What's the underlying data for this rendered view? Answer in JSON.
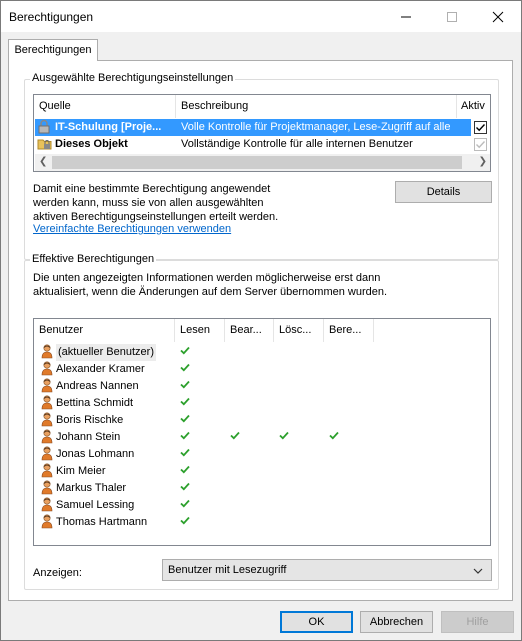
{
  "window": {
    "title": "Berechtigungen"
  },
  "tab": {
    "label": "Berechtigungen"
  },
  "selected_settings": {
    "legend": "Ausgewählte Berechtigungseinstellungen",
    "columns": [
      "Quelle",
      "Beschreibung",
      "Aktiv"
    ],
    "rows": [
      {
        "source": "IT-Schulung [Proje...",
        "description": "Volle Kontrolle für Projektmanager, Lese-Zugriff auf alle",
        "active": true,
        "selected": true
      },
      {
        "source": "Dieses Objekt",
        "description": "Vollständige Kontrolle für alle internen Benutzer",
        "active": true,
        "selected": false
      }
    ],
    "note": [
      "Damit eine bestimmte Berechtigung angewendet",
      "werden kann, muss sie von allen ausgewählten",
      "aktiven Berechtigungseinstellungen erteilt werden."
    ],
    "details_button": "Details",
    "simplified_link": "Vereinfachte Berechtigungen verwenden"
  },
  "effective": {
    "legend": "Effektive Berechtigungen",
    "info": [
      "Die unten angezeigten Informationen werden möglicherweise erst dann",
      "aktualisiert, wenn die Änderungen auf dem Server übernommen wurden."
    ],
    "columns": [
      "Benutzer",
      "Lesen",
      "Bear...",
      "Lösc...",
      "Bere..."
    ],
    "users": [
      {
        "name": "(aktueller Benutzer)",
        "read": true,
        "edit": false,
        "delete": false,
        "perm": false
      },
      {
        "name": "Alexander Kramer",
        "read": true,
        "edit": false,
        "delete": false,
        "perm": false
      },
      {
        "name": "Andreas Nannen",
        "read": true,
        "edit": false,
        "delete": false,
        "perm": false
      },
      {
        "name": "Bettina Schmidt",
        "read": true,
        "edit": false,
        "delete": false,
        "perm": false
      },
      {
        "name": "Boris Rischke",
        "read": true,
        "edit": false,
        "delete": false,
        "perm": false
      },
      {
        "name": "Johann Stein",
        "read": true,
        "edit": true,
        "delete": true,
        "perm": true
      },
      {
        "name": "Jonas Lohmann",
        "read": true,
        "edit": false,
        "delete": false,
        "perm": false
      },
      {
        "name": "Kim Meier",
        "read": true,
        "edit": false,
        "delete": false,
        "perm": false
      },
      {
        "name": "Markus Thaler",
        "read": true,
        "edit": false,
        "delete": false,
        "perm": false
      },
      {
        "name": "Samuel Lessing",
        "read": true,
        "edit": false,
        "delete": false,
        "perm": false
      },
      {
        "name": "Thomas Hartmann",
        "read": true,
        "edit": false,
        "delete": false,
        "perm": false
      }
    ],
    "show_label": "Anzeigen:",
    "show_value": "Benutzer mit Lesezugriff"
  },
  "buttons": {
    "ok": "OK",
    "cancel": "Abbrechen",
    "help": "Hilfe"
  },
  "colors": {
    "selection": "#3399ff",
    "check": "#2ca02c",
    "link": "#0066cc"
  }
}
